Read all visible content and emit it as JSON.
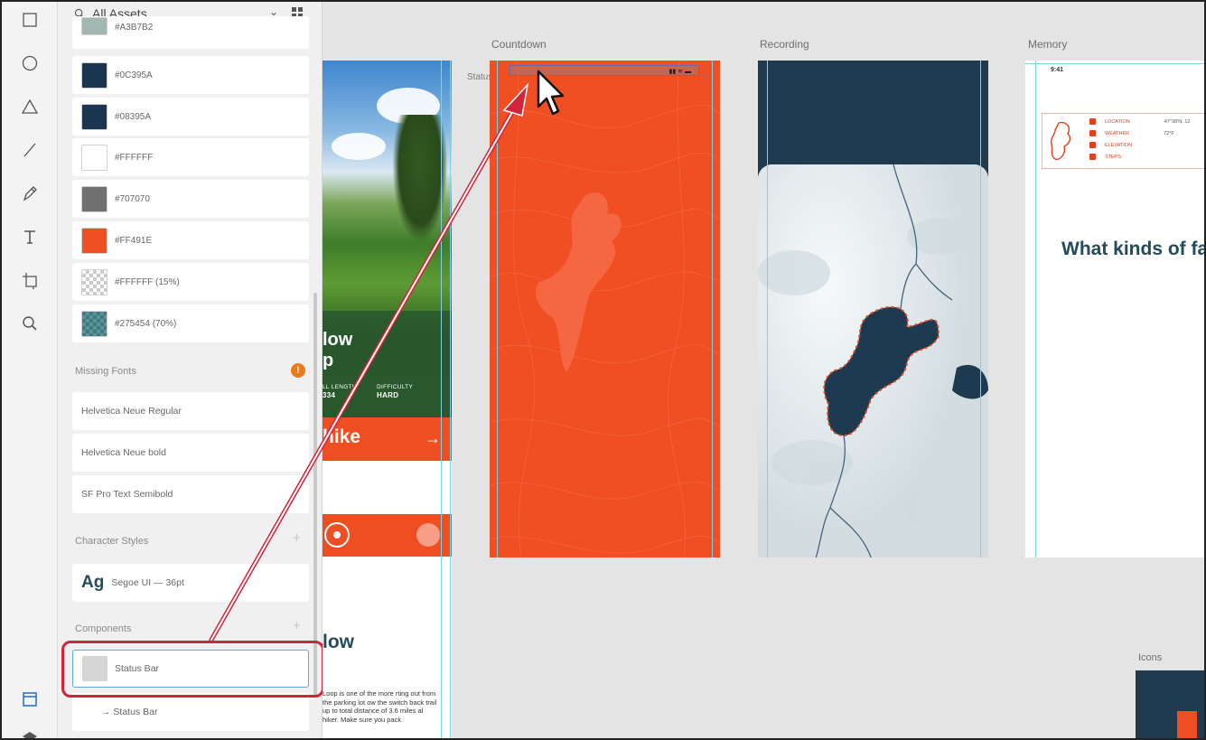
{
  "assets_panel": {
    "search_label": "All Assets",
    "colors": [
      {
        "hex": "#A3B7B2",
        "swatch": "#a3b7b2"
      },
      {
        "hex": "#0C395A",
        "swatch": "#1c3550"
      },
      {
        "hex": "#08395A",
        "swatch": "#1c3550"
      },
      {
        "hex": "#FFFFFF",
        "swatch": "#ffffff"
      },
      {
        "hex": "#707070",
        "swatch": "#707070"
      },
      {
        "hex": "#FF491E",
        "swatch": "#f04e23"
      },
      {
        "hex": "#FFFFFF (15%)",
        "swatch": "checker"
      },
      {
        "hex": "#275454 (70%)",
        "swatch": "teal"
      }
    ],
    "missing_fonts_title": "Missing Fonts",
    "missing_fonts_badge": "!",
    "missing_fonts": [
      "Helvetica Neue Regular",
      "Helvetica Neue bold",
      "SF Pro Text Semibold"
    ],
    "character_styles_title": "Character Styles",
    "character_style_sample": "Ag",
    "character_style_desc": "Segoe UI — 36pt",
    "components_title": "Components",
    "components": [
      "Status Bar",
      "→ Status Bar"
    ],
    "plus": "+"
  },
  "canvas": {
    "artboards": {
      "countdown": "Countdown",
      "recording": "Recording",
      "memory": "Memory",
      "icons": "Icons"
    },
    "status_label": "Status",
    "ab1": {
      "big1": "low",
      "big2": "p",
      "stat1": "LL LENGTH",
      "stat1_val": "334",
      "stat2": "DIFFICULTY",
      "stat2_val": "HARD",
      "hike": "hike",
      "arrow": "→",
      "title2": "low",
      "para": "Loop is one of the more rting out from the parking lot ow the switch back trail up to total distance of 3.6 miles al hiker. Make sure you pack"
    },
    "memory": {
      "time": "9:41",
      "question": "What kinds of fauna do you se",
      "rows": [
        {
          "label": "LOCATION",
          "value": "47°38'N, 12"
        },
        {
          "label": "WEATHER",
          "value": "72°F"
        },
        {
          "label": "ELEVATION",
          "value": ""
        },
        {
          "label": "STEPS",
          "value": ""
        }
      ]
    },
    "countdown_signal": "▮▮ ≋ ▬"
  },
  "colors": {
    "accent": "#f04e23",
    "navy": "#203a4f",
    "highlight": "#d1233a"
  }
}
